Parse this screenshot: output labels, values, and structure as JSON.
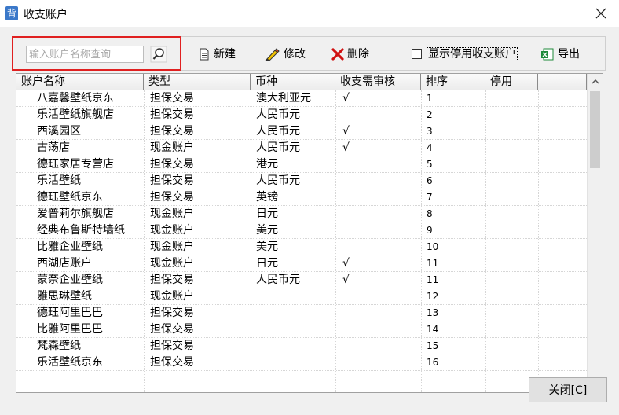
{
  "window": {
    "title": "收支账户",
    "icon_glyph": "背"
  },
  "toolbar": {
    "search_placeholder": "输入账户名称查询",
    "new_label": "新建",
    "edit_label": "修改",
    "delete_label": "删除",
    "show_disabled_label": "显示停用收支账户",
    "show_disabled_checked": false,
    "export_label": "导出"
  },
  "table": {
    "columns": [
      "账户名称",
      "类型",
      "币种",
      "收支需审核",
      "排序",
      "停用"
    ],
    "rows": [
      [
        "八嘉馨壁纸京东",
        "担保交易",
        "澳大利亚元",
        "√",
        "1",
        ""
      ],
      [
        "乐活壁纸旗舰店",
        "担保交易",
        "人民币元",
        "",
        "2",
        ""
      ],
      [
        "西溪园区",
        "担保交易",
        "人民币元",
        "√",
        "3",
        ""
      ],
      [
        "古荡店",
        "现金账户",
        "人民币元",
        "√",
        "4",
        ""
      ],
      [
        "德珏家居专营店",
        "担保交易",
        "港元",
        "",
        "5",
        ""
      ],
      [
        "乐活壁纸",
        "担保交易",
        "人民币元",
        "",
        "6",
        ""
      ],
      [
        "德珏壁纸京东",
        "担保交易",
        "英镑",
        "",
        "7",
        ""
      ],
      [
        "爱普莉尔旗舰店",
        "现金账户",
        "日元",
        "",
        "8",
        ""
      ],
      [
        "经典布鲁斯特墙纸",
        "现金账户",
        "美元",
        "",
        "9",
        ""
      ],
      [
        "比雅企业壁纸",
        "现金账户",
        "美元",
        "",
        "10",
        ""
      ],
      [
        "西湖店账户",
        "现金账户",
        "日元",
        "√",
        "11",
        ""
      ],
      [
        "蒙奈企业壁纸",
        "担保交易",
        "人民币元",
        "√",
        "11",
        ""
      ],
      [
        "雅思琳壁纸",
        "现金账户",
        "",
        "",
        "12",
        ""
      ],
      [
        "德珏阿里巴巴",
        "担保交易",
        "",
        "",
        "13",
        ""
      ],
      [
        "比雅阿里巴巴",
        "担保交易",
        "",
        "",
        "14",
        ""
      ],
      [
        "梵森壁纸",
        "担保交易",
        "",
        "",
        "15",
        ""
      ],
      [
        "乐活壁纸京东",
        "担保交易",
        "",
        "",
        "16",
        ""
      ]
    ]
  },
  "footer": {
    "close_label": "关闭[C]"
  },
  "colors": {
    "highlight": "#e02020",
    "delete_icon": "#d01010",
    "export_icon": "#1e8a3a"
  }
}
